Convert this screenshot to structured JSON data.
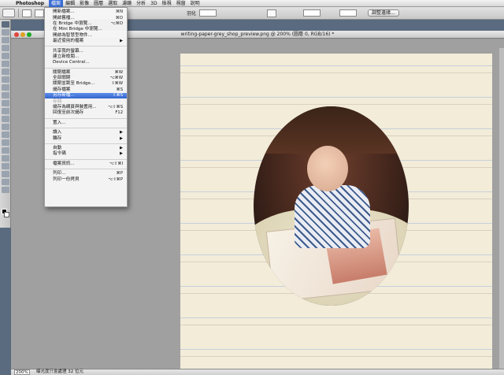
{
  "menubar": {
    "app_name": "Photoshop",
    "items": [
      "檔案",
      "編輯",
      "影像",
      "圖層",
      "選取",
      "濾鏡",
      "分析",
      "3D",
      "檢視",
      "視窗",
      "說明"
    ],
    "active_index": 0
  },
  "options": {
    "field_label": "羽化",
    "field_value": "",
    "button_label": "調整邊緣..."
  },
  "document": {
    "title": "writing-paper-grey_shop_preview.png @ 200% (圖層 0, RGB/16) *"
  },
  "status": {
    "zoom": "200%",
    "info": "曝光度只會處理 32 位元"
  },
  "file_menu": {
    "items": [
      {
        "label": "開新檔案...",
        "shortcut": "⌘N",
        "disabled": false
      },
      {
        "label": "開啟舊檔...",
        "shortcut": "⌘O",
        "disabled": false
      },
      {
        "label": "在 Bridge 中瀏覽...",
        "shortcut": "⌥⌘O",
        "disabled": false
      },
      {
        "label": "在 Mini Bridge 中瀏覽...",
        "shortcut": "",
        "disabled": false
      },
      {
        "label": "開啟為智慧型物件...",
        "shortcut": "",
        "disabled": false
      },
      {
        "label": "最近使用的檔案",
        "shortcut": "▶",
        "disabled": false
      },
      {
        "sep": true
      },
      {
        "label": "共享我的螢幕...",
        "shortcut": "",
        "disabled": false
      },
      {
        "label": "建立新檢閱...",
        "shortcut": "",
        "disabled": false
      },
      {
        "label": "Device Central...",
        "shortcut": "",
        "disabled": false
      },
      {
        "sep": true
      },
      {
        "label": "關閉檔案",
        "shortcut": "⌘W",
        "disabled": false
      },
      {
        "label": "全部關閉",
        "shortcut": "⌥⌘W",
        "disabled": false
      },
      {
        "label": "關閉並跳至 Bridge...",
        "shortcut": "⇧⌘W",
        "disabled": false
      },
      {
        "label": "儲存檔案",
        "shortcut": "⌘S",
        "disabled": false
      },
      {
        "label": "另存新檔...",
        "shortcut": "⇧⌘S",
        "disabled": false,
        "highlighted": true
      },
      {
        "label": "存回",
        "shortcut": "",
        "disabled": true
      },
      {
        "label": "儲存為網頁與裝置用...",
        "shortcut": "⌥⇧⌘S",
        "disabled": false
      },
      {
        "label": "回復至前次儲存",
        "shortcut": "F12",
        "disabled": false
      },
      {
        "sep": true
      },
      {
        "label": "置入...",
        "shortcut": "",
        "disabled": false
      },
      {
        "sep": true
      },
      {
        "label": "讀入",
        "shortcut": "▶",
        "disabled": false
      },
      {
        "label": "轉存",
        "shortcut": "▶",
        "disabled": false
      },
      {
        "sep": true
      },
      {
        "label": "自動",
        "shortcut": "▶",
        "disabled": false
      },
      {
        "label": "指令碼",
        "shortcut": "▶",
        "disabled": false
      },
      {
        "sep": true
      },
      {
        "label": "檔案資訊...",
        "shortcut": "⌥⇧⌘I",
        "disabled": false
      },
      {
        "sep": true
      },
      {
        "label": "列印...",
        "shortcut": "⌘P",
        "disabled": false
      },
      {
        "label": "列印一份拷貝",
        "shortcut": "⌥⇧⌘P",
        "disabled": false
      }
    ]
  }
}
